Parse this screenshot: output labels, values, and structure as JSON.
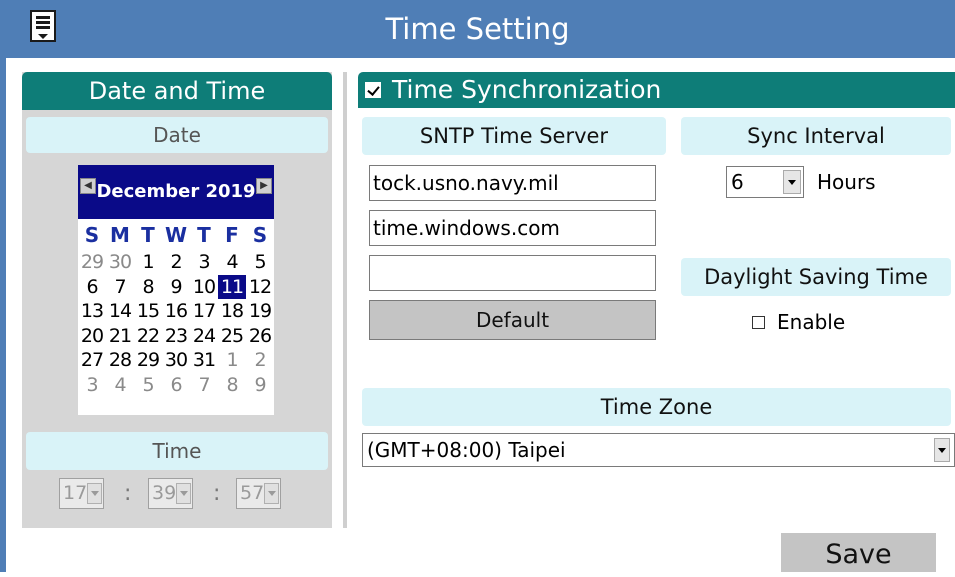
{
  "header": {
    "title": "Time Setting",
    "menu_icon": "menu-icon"
  },
  "date_time": {
    "heading": "Date and Time",
    "date_label": "Date",
    "time_label": "Time",
    "calendar": {
      "month_title": "December 2019",
      "nav_prev_icon": "left-arrow-icon",
      "nav_next_icon": "right-arrow-icon",
      "weekdays": [
        "S",
        "M",
        "T",
        "W",
        "T",
        "F",
        "S"
      ],
      "days": [
        {
          "d": "29",
          "dim": true
        },
        {
          "d": "30",
          "dim": true
        },
        {
          "d": "1"
        },
        {
          "d": "2"
        },
        {
          "d": "3"
        },
        {
          "d": "4"
        },
        {
          "d": "5"
        },
        {
          "d": "6"
        },
        {
          "d": "7"
        },
        {
          "d": "8"
        },
        {
          "d": "9"
        },
        {
          "d": "10"
        },
        {
          "d": "11",
          "selected": true
        },
        {
          "d": "12"
        },
        {
          "d": "13"
        },
        {
          "d": "14"
        },
        {
          "d": "15"
        },
        {
          "d": "16"
        },
        {
          "d": "17"
        },
        {
          "d": "18"
        },
        {
          "d": "19"
        },
        {
          "d": "20"
        },
        {
          "d": "21"
        },
        {
          "d": "22"
        },
        {
          "d": "23"
        },
        {
          "d": "24"
        },
        {
          "d": "25"
        },
        {
          "d": "26"
        },
        {
          "d": "27"
        },
        {
          "d": "28"
        },
        {
          "d": "29"
        },
        {
          "d": "30"
        },
        {
          "d": "31"
        },
        {
          "d": "1",
          "dim": true
        },
        {
          "d": "2",
          "dim": true
        },
        {
          "d": "3",
          "dim": true
        },
        {
          "d": "4",
          "dim": true
        },
        {
          "d": "5",
          "dim": true
        },
        {
          "d": "6",
          "dim": true
        },
        {
          "d": "7",
          "dim": true
        },
        {
          "d": "8",
          "dim": true
        },
        {
          "d": "9",
          "dim": true
        }
      ]
    },
    "time": {
      "hour": "17",
      "minute": "39",
      "second": "57",
      "separator": ":"
    }
  },
  "sync": {
    "checkbox_label": "Time Synchronization",
    "checked": true,
    "sntp_label": "SNTP Time Server",
    "servers": [
      "tock.usno.navy.mil",
      "time.windows.com",
      ""
    ],
    "default_button": "Default",
    "interval_label": "Sync Interval",
    "interval_value": "6",
    "interval_unit": "Hours"
  },
  "dst": {
    "label": "Daylight Saving Time",
    "enable_label": "Enable",
    "checked": false
  },
  "timezone": {
    "label": "Time Zone",
    "value": "(GMT+08:00) Taipei"
  },
  "save_button": "Save",
  "colors": {
    "title_bar": "#4f7eb6",
    "teal": "#0e7d78",
    "cyan": "#d9f3f8",
    "calendar_navy": "#0a0a88"
  }
}
